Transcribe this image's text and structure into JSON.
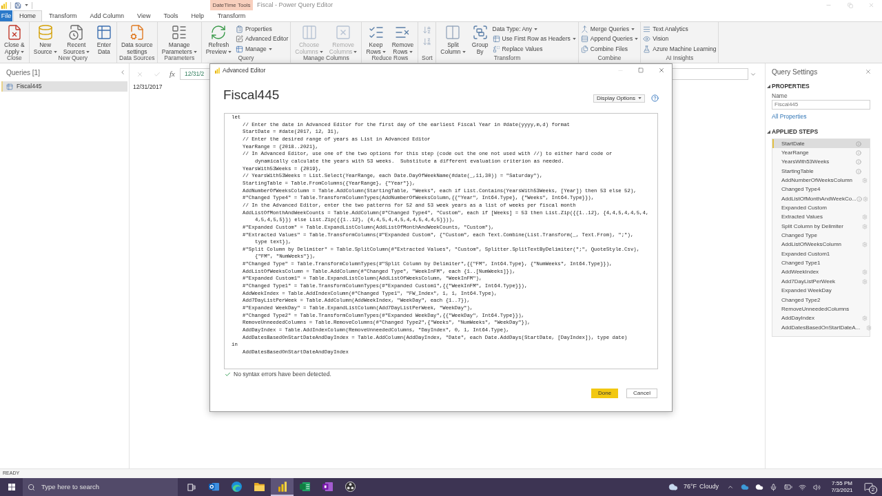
{
  "title_bar": {
    "title": "Fiscal - Power Query Editor",
    "contextual_group": "DateTime Tools"
  },
  "ribbon_tabs": [
    {
      "label": "File",
      "kind": "file",
      "selected": false
    },
    {
      "label": "Home",
      "kind": "standard",
      "selected": true
    },
    {
      "label": "Transform",
      "kind": "standard",
      "selected": false
    },
    {
      "label": "Add Column",
      "kind": "standard",
      "selected": false
    },
    {
      "label": "View",
      "kind": "standard",
      "selected": false
    },
    {
      "label": "Tools",
      "kind": "standard",
      "selected": false
    },
    {
      "label": "Help",
      "kind": "standard",
      "selected": false
    },
    {
      "label": "Transform",
      "kind": "contextual",
      "selected": false
    }
  ],
  "ribbon_groups": [
    {
      "label": "Close",
      "kind": "buttons",
      "items": [
        {
          "kind": "large",
          "lines": [
            "Close &",
            "Apply"
          ],
          "dropdown": true,
          "disabled": false
        }
      ]
    },
    {
      "label": "New Query",
      "kind": "buttons",
      "items": [
        {
          "kind": "large",
          "lines": [
            "New",
            "Source"
          ],
          "dropdown": true,
          "disabled": false
        },
        {
          "kind": "large",
          "lines": [
            "Recent",
            "Sources"
          ],
          "dropdown": true,
          "disabled": false
        },
        {
          "kind": "large",
          "lines": [
            "Enter",
            "Data"
          ],
          "dropdown": false,
          "disabled": false
        }
      ]
    },
    {
      "label": "Data Sources",
      "kind": "buttons",
      "items": [
        {
          "kind": "large",
          "lines": [
            "Data source",
            "settings"
          ],
          "dropdown": false,
          "disabled": false
        }
      ]
    },
    {
      "label": "Parameters",
      "kind": "buttons",
      "items": [
        {
          "kind": "large",
          "lines": [
            "Manage",
            "Parameters"
          ],
          "dropdown": true,
          "disabled": false
        }
      ]
    },
    {
      "label": "Query",
      "kind": "buttons",
      "items": [
        {
          "kind": "large",
          "lines": [
            "Refresh",
            "Preview"
          ],
          "dropdown": true,
          "disabled": false
        },
        {
          "kind": "small",
          "lines": [
            "Properties"
          ],
          "dropdown": false,
          "disabled": false
        },
        {
          "kind": "small",
          "lines": [
            "Advanced Editor"
          ],
          "dropdown": false,
          "disabled": false
        },
        {
          "kind": "small",
          "lines": [
            "Manage"
          ],
          "dropdown": true,
          "disabled": false
        }
      ]
    },
    {
      "label": "Manage Columns",
      "kind": "buttons",
      "items": [
        {
          "kind": "large",
          "lines": [
            "Choose",
            "Columns"
          ],
          "dropdown": true,
          "disabled": true
        },
        {
          "kind": "large",
          "lines": [
            "Remove",
            "Columns"
          ],
          "dropdown": true,
          "disabled": true
        }
      ]
    },
    {
      "label": "Reduce Rows",
      "kind": "buttons",
      "items": [
        {
          "kind": "large",
          "lines": [
            "Keep",
            "Rows"
          ],
          "dropdown": true,
          "disabled": false
        },
        {
          "kind": "large",
          "lines": [
            "Remove",
            "Rows"
          ],
          "dropdown": true,
          "disabled": false
        }
      ]
    },
    {
      "label": "Sort",
      "kind": "icons"
    },
    {
      "label": "Transform",
      "kind": "buttons",
      "items": [
        {
          "kind": "large",
          "lines": [
            "Split",
            "Column"
          ],
          "dropdown": true,
          "disabled": false
        },
        {
          "kind": "large",
          "lines": [
            "Group",
            "By"
          ],
          "dropdown": false,
          "disabled": false
        },
        {
          "kind": "small",
          "lines": [
            "Data Type: Any"
          ],
          "dropdown": true,
          "disabled": false
        },
        {
          "kind": "small",
          "lines": [
            "Use First Row as Headers"
          ],
          "dropdown": true,
          "disabled": false
        },
        {
          "kind": "small",
          "lines": [
            "Replace Values"
          ],
          "dropdown": false,
          "disabled": false
        }
      ]
    },
    {
      "label": "Combine",
      "kind": "buttons",
      "items": [
        {
          "kind": "small",
          "lines": [
            "Merge Queries"
          ],
          "dropdown": true,
          "disabled": false
        },
        {
          "kind": "small",
          "lines": [
            "Append Queries"
          ],
          "dropdown": true,
          "disabled": false
        },
        {
          "kind": "small",
          "lines": [
            "Combine Files"
          ],
          "dropdown": false,
          "disabled": false
        }
      ]
    },
    {
      "label": "AI Insights",
      "kind": "buttons",
      "items": [
        {
          "kind": "small",
          "lines": [
            "Text Analytics"
          ],
          "dropdown": false,
          "disabled": false
        },
        {
          "kind": "small",
          "lines": [
            "Vision"
          ],
          "dropdown": false,
          "disabled": false
        },
        {
          "kind": "small",
          "lines": [
            "Azure Machine Learning"
          ],
          "dropdown": false,
          "disabled": false
        }
      ]
    }
  ],
  "queries_panel": {
    "title": "Queries [1]",
    "items": [
      {
        "label": "Fiscal445",
        "selected": true
      }
    ]
  },
  "formula_bar": {
    "fx_label": "fx",
    "formula": "12/31/2"
  },
  "preview": {
    "value": "12/31/2017"
  },
  "query_settings": {
    "title": "Query Settings",
    "properties": {
      "heading": "PROPERTIES",
      "expanded": true,
      "name_label": "Name",
      "name_value": "Fiscal445",
      "all_properties": "All Properties"
    },
    "applied_steps": {
      "heading": "APPLIED STEPS",
      "expanded": true,
      "steps": [
        {
          "label": "StartDate",
          "selected": true,
          "info": true,
          "settings": false
        },
        {
          "label": "YearRange",
          "selected": false,
          "info": true,
          "settings": false
        },
        {
          "label": "YearsWith53Weeks",
          "selected": false,
          "info": true,
          "settings": false
        },
        {
          "label": "StartingTable",
          "selected": false,
          "info": true,
          "settings": false
        },
        {
          "label": "AddNumberOfWeeksColumn",
          "selected": false,
          "info": false,
          "settings": true
        },
        {
          "label": "Changed Type4",
          "selected": false,
          "info": false,
          "settings": false
        },
        {
          "label": "AddListOfMonthAndWeekCo...",
          "selected": false,
          "info": true,
          "settings": true
        },
        {
          "label": "Expanded Custom",
          "selected": false,
          "info": false,
          "settings": false
        },
        {
          "label": "Extracted Values",
          "selected": false,
          "info": false,
          "settings": true
        },
        {
          "label": "Split Column by Delimiter",
          "selected": false,
          "info": false,
          "settings": true
        },
        {
          "label": "Changed Type",
          "selected": false,
          "info": false,
          "settings": false
        },
        {
          "label": "AddListOfWeeksColumn",
          "selected": false,
          "info": false,
          "settings": true
        },
        {
          "label": "Expanded Custom1",
          "selected": false,
          "info": false,
          "settings": false
        },
        {
          "label": "Changed Type1",
          "selected": false,
          "info": false,
          "settings": false
        },
        {
          "label": "AddWeekIndex",
          "selected": false,
          "info": false,
          "settings": true
        },
        {
          "label": "Add7DayListPerWeek",
          "selected": false,
          "info": false,
          "settings": true
        },
        {
          "label": "Expanded WeekDay",
          "selected": false,
          "info": false,
          "settings": false
        },
        {
          "label": "Changed Type2",
          "selected": false,
          "info": false,
          "settings": false
        },
        {
          "label": "RemoveUnneededColumns",
          "selected": false,
          "info": false,
          "settings": false
        },
        {
          "label": "AddDayIndex",
          "selected": false,
          "info": false,
          "settings": true
        },
        {
          "label": "AddDatesBasedOnStartDateA...",
          "selected": false,
          "info": false,
          "settings": true
        }
      ]
    }
  },
  "status_bar": {
    "text": "READY"
  },
  "taskbar": {
    "search_placeholder": "Type here to search",
    "apps": [
      {
        "selected": false
      },
      {
        "selected": false
      },
      {
        "selected": false
      },
      {
        "selected": true
      },
      {
        "selected": false
      },
      {
        "selected": false
      },
      {
        "selected": false
      }
    ],
    "weather": {
      "temperature": "76°F",
      "condition": "Cloudy"
    },
    "clock": {
      "time": "7:55 PM",
      "date": "7/3/2021"
    },
    "notification_count": "2"
  },
  "advanced_editor": {
    "title": "Advanced Editor",
    "query_name": "Fiscal445",
    "display_options": "Display Options",
    "code": [
      {
        "keyword": "let",
        "lines": [
          {
            "text": "// Enter the date in Advanced Editor for the first day of the earliest Fiscal Year in #date(yyyy,m,d) format"
          },
          {
            "text": "StartDate = #date(2017, 12, 31),"
          },
          {
            "text": "// Enter the desired range of years as List in Advanced Editor"
          },
          {
            "text": "YearRange = {2018..2021},"
          },
          {
            "text": "// In Advanced Editor, use one of the two options for this step (code out the one not used with //) to either hard code or",
            "wrapped": [
              "dynamically calculate the years with 53 weeks.  Substitute a different evaluation criterion as needed."
            ]
          },
          {
            "text": "YearsWith53Weeks = {2019},"
          },
          {
            "text": "// YearsWith53Weeks = List.Select(YearRange, each Date.DayOfWeekName(#date(_,11,30)) = \"Saturday\"),"
          },
          {
            "text": "StartingTable = Table.FromColumns({YearRange}, {\"Year\"}),"
          },
          {
            "text": "AddNumberOfWeeksColumn = Table.AddColumn(StartingTable, \"Weeks\", each if List.Contains(YearsWith53Weeks, [Year]) then 53 else 52),"
          },
          {
            "text": "#\"Changed Type4\" = Table.TransformColumnTypes(AddNumberOfWeeksColumn,{{\"Year\", Int64.Type}, {\"Weeks\", Int64.Type}}),"
          },
          {
            "text": "// In the Advanced Editor, enter the two patterns for 52 and 53 week years as a list of weeks per fiscal month"
          },
          {
            "text": "AddListOfMonthAndWeekCounts = Table.AddColumn(#\"Changed Type4\", \"Custom\", each if [Weeks] = 53 then List.Zip({{1..12}, {4,4,5,4,4,5,4,",
            "wrapped": [
              "4,5,4,5,5}}) else List.Zip({{1..12}, {4,4,5,4,4,5,4,4,5,4,4,5}})),"
            ]
          },
          {
            "text": "#\"Expanded Custom\" = Table.ExpandListColumn(AddListOfMonthAndWeekCounts, \"Custom\"),"
          },
          {
            "text": "#\"Extracted Values\" = Table.TransformColumns(#\"Expanded Custom\", {\"Custom\", each Text.Combine(List.Transform(_, Text.From), \";\"),",
            "wrapped": [
              "type text}),"
            ]
          },
          {
            "text": "#\"Split Column by Delimiter\" = Table.SplitColumn(#\"Extracted Values\", \"Custom\", Splitter.SplitTextByDelimiter(\";\", QuoteStyle.Csv),",
            "wrapped": [
              "{\"FM\", \"NumWeeks\"}),"
            ]
          },
          {
            "text": "#\"Changed Type\" = Table.TransformColumnTypes(#\"Split Column by Delimiter\",{{\"FM\", Int64.Type}, {\"NumWeeks\", Int64.Type}}),"
          },
          {
            "text": "AddListOfWeeksColumn = Table.AddColumn(#\"Changed Type\", \"WeekInFM\", each {1..[NumWeeks]}),"
          },
          {
            "text": "#\"Expanded Custom1\" = Table.ExpandListColumn(AddListOfWeeksColumn, \"WeekInFM\"),"
          },
          {
            "text": "#\"Changed Type1\" = Table.TransformColumnTypes(#\"Expanded Custom1\",{{\"WeekInFM\", Int64.Type}}),"
          },
          {
            "text": "AddWeekIndex = Table.AddIndexColumn(#\"Changed Type1\", \"FW_Index\", 1, 1, Int64.Type),"
          },
          {
            "text": "Add7DayListPerWeek = Table.AddColumn(AddWeekIndex, \"WeekDay\", each {1..7}),"
          },
          {
            "text": "#\"Expanded WeekDay\" = Table.ExpandListColumn(Add7DayListPerWeek, \"WeekDay\"),"
          },
          {
            "text": "#\"Changed Type2\" = Table.TransformColumnTypes(#\"Expanded WeekDay\",{{\"WeekDay\", Int64.Type}}),"
          },
          {
            "text": "RemoveUnneededColumns = Table.RemoveColumns(#\"Changed Type2\",{\"Weeks\", \"NumWeeks\", \"WeekDay\"}),"
          },
          {
            "text": "AddDayIndex = Table.AddIndexColumn(RemoveUnneededColumns, \"DayIndex\", 0, 1, Int64.Type),"
          },
          {
            "text": "AddDatesBasedOnStartDateAndDayIndex = Table.AddColumn(AddDayIndex, \"Date\", each Date.AddDays(StartDate, [DayIndex]), type date)"
          }
        ]
      },
      {
        "keyword": "in",
        "lines": [
          {
            "text": "AddDatesBasedOnStartDateAndDayIndex"
          }
        ]
      }
    ],
    "status": "No syntax errors have been detected.",
    "buttons": [
      {
        "label": "Done",
        "kind": "primary"
      },
      {
        "label": "Cancel",
        "kind": "secondary"
      }
    ]
  }
}
